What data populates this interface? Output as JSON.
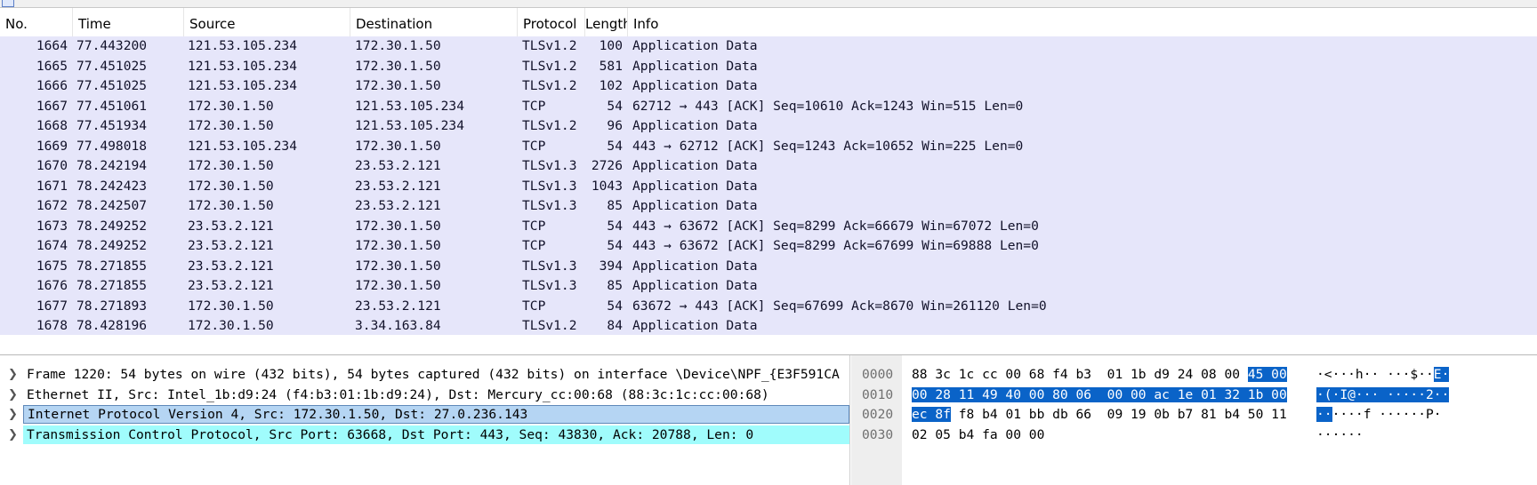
{
  "columns": {
    "no": "No.",
    "time": "Time",
    "source": "Source",
    "destination": "Destination",
    "protocol": "Protocol",
    "length": "Length",
    "info": "Info"
  },
  "packets": [
    {
      "no": "1664",
      "time": "77.443200",
      "src": "121.53.105.234",
      "dst": "172.30.1.50",
      "proto": "TLSv1.2",
      "len": "100",
      "info": "Application Data"
    },
    {
      "no": "1665",
      "time": "77.451025",
      "src": "121.53.105.234",
      "dst": "172.30.1.50",
      "proto": "TLSv1.2",
      "len": "581",
      "info": "Application Data"
    },
    {
      "no": "1666",
      "time": "77.451025",
      "src": "121.53.105.234",
      "dst": "172.30.1.50",
      "proto": "TLSv1.2",
      "len": "102",
      "info": "Application Data"
    },
    {
      "no": "1667",
      "time": "77.451061",
      "src": "172.30.1.50",
      "dst": "121.53.105.234",
      "proto": "TCP",
      "len": "54",
      "info": "62712 → 443 [ACK] Seq=10610 Ack=1243 Win=515 Len=0"
    },
    {
      "no": "1668",
      "time": "77.451934",
      "src": "172.30.1.50",
      "dst": "121.53.105.234",
      "proto": "TLSv1.2",
      "len": "96",
      "info": "Application Data"
    },
    {
      "no": "1669",
      "time": "77.498018",
      "src": "121.53.105.234",
      "dst": "172.30.1.50",
      "proto": "TCP",
      "len": "54",
      "info": "443 → 62712 [ACK] Seq=1243 Ack=10652 Win=225 Len=0"
    },
    {
      "no": "1670",
      "time": "78.242194",
      "src": "172.30.1.50",
      "dst": "23.53.2.121",
      "proto": "TLSv1.3",
      "len": "2726",
      "info": "Application Data"
    },
    {
      "no": "1671",
      "time": "78.242423",
      "src": "172.30.1.50",
      "dst": "23.53.2.121",
      "proto": "TLSv1.3",
      "len": "1043",
      "info": "Application Data"
    },
    {
      "no": "1672",
      "time": "78.242507",
      "src": "172.30.1.50",
      "dst": "23.53.2.121",
      "proto": "TLSv1.3",
      "len": "85",
      "info": "Application Data"
    },
    {
      "no": "1673",
      "time": "78.249252",
      "src": "23.53.2.121",
      "dst": "172.30.1.50",
      "proto": "TCP",
      "len": "54",
      "info": "443 → 63672 [ACK] Seq=8299 Ack=66679 Win=67072 Len=0"
    },
    {
      "no": "1674",
      "time": "78.249252",
      "src": "23.53.2.121",
      "dst": "172.30.1.50",
      "proto": "TCP",
      "len": "54",
      "info": "443 → 63672 [ACK] Seq=8299 Ack=67699 Win=69888 Len=0"
    },
    {
      "no": "1675",
      "time": "78.271855",
      "src": "23.53.2.121",
      "dst": "172.30.1.50",
      "proto": "TLSv1.3",
      "len": "394",
      "info": "Application Data"
    },
    {
      "no": "1676",
      "time": "78.271855",
      "src": "23.53.2.121",
      "dst": "172.30.1.50",
      "proto": "TLSv1.3",
      "len": "85",
      "info": "Application Data"
    },
    {
      "no": "1677",
      "time": "78.271893",
      "src": "172.30.1.50",
      "dst": "23.53.2.121",
      "proto": "TCP",
      "len": "54",
      "info": "63672 → 443 [ACK] Seq=67699 Ack=8670 Win=261120 Len=0"
    },
    {
      "no": "1678",
      "time": "78.428196",
      "src": "172.30.1.50",
      "dst": "3.34.163.84",
      "proto": "TLSv1.2",
      "len": "84",
      "info": "Application Data"
    }
  ],
  "details": [
    {
      "text": "Frame 1220: 54 bytes on wire (432 bits), 54 bytes captured (432 bits) on interface \\Device\\NPF_{E3F591CA"
    },
    {
      "text": "Ethernet II, Src: Intel_1b:d9:24 (f4:b3:01:1b:d9:24), Dst: Mercury_cc:00:68 (88:3c:1c:cc:00:68)"
    },
    {
      "text": "Internet Protocol Version 4, Src: 172.30.1.50, Dst: 27.0.236.143"
    },
    {
      "text": "Transmission Control Protocol, Src Port: 63668, Dst Port: 443, Seq: 43830, Ack: 20788, Len: 0"
    }
  ],
  "hex_rows": [
    {
      "offset": "0000",
      "bytes": "88 3c 1c cc 00 68 f4 b3  01 1b d9 24 08 00 ",
      "bytes_hl": "45 00",
      "ascii": "·<···h·· ···$··",
      "ascii_hl": "E·"
    },
    {
      "offset": "0010",
      "bytes": "",
      "bytes_hl": "00 28 11 49 40 00 80 06  00 00 ac 1e 01 32 1b 00",
      "ascii": "",
      "ascii_hl": "·(·I@··· ·····2··"
    },
    {
      "offset": "0020",
      "bytes_hl": "ec 8f",
      "bytes": " f8 b4 01 bb db 66  09 19 0b b7 81 b4 50 11",
      "ascii_hl": "··",
      "ascii": "····f ······P·"
    },
    {
      "offset": "0030",
      "bytes": "02 05 b4 fa 00 00",
      "bytes_hl": "",
      "ascii": "······",
      "ascii_hl": ""
    }
  ],
  "icons": {
    "expand": "chevron-right-icon"
  }
}
